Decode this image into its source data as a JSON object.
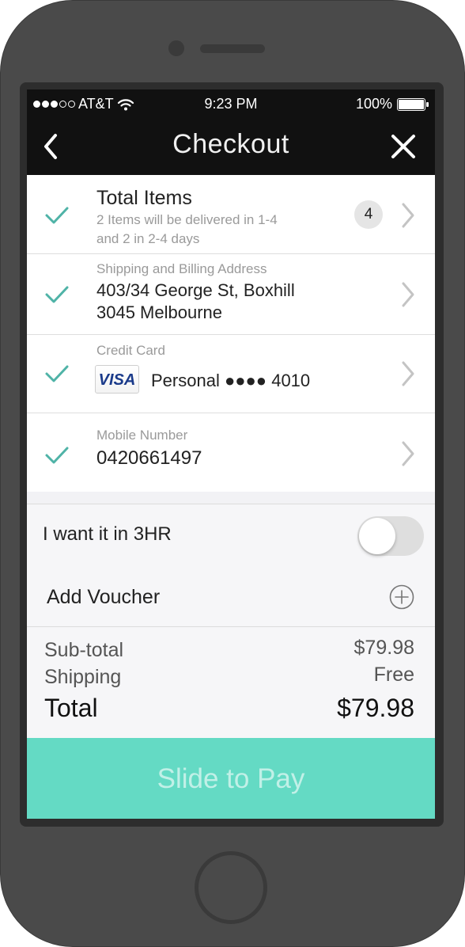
{
  "status_bar": {
    "carrier": "AT&T",
    "time": "9:23 PM",
    "battery": "100%",
    "signal_bars_filled": 3,
    "signal_bars_total": 5
  },
  "nav": {
    "title": "Checkout",
    "back_icon": "chevron-left-icon",
    "close_icon": "close-icon"
  },
  "rows": {
    "items": {
      "title": "Total Items",
      "subtitle_line1": "2 Items will be delivered in 1-4",
      "subtitle_line2": "and 2 in 2-4 days",
      "count": "4"
    },
    "address": {
      "label": "Shipping and Billing Address",
      "line1": "403/34 George St, Boxhill",
      "line2": "3045 Melbourne"
    },
    "card": {
      "label": "Credit Card",
      "brand": "VISA",
      "description": "Personal ●●●● 4010"
    },
    "mobile": {
      "label": "Mobile Number",
      "value": "0420661497"
    }
  },
  "options": {
    "express_label": "I want it in 3HR",
    "express_enabled": false,
    "voucher_label": "Add Voucher"
  },
  "totals": {
    "subtotal_label": "Sub-total",
    "subtotal_value": "$79.98",
    "shipping_label": "Shipping",
    "shipping_value": "Free",
    "total_label": "Total",
    "total_value": "$79.98"
  },
  "pay": {
    "label": "Slide to Pay"
  },
  "colors": {
    "accent_teal": "#64dac4",
    "check_teal": "#4fb3a7",
    "nav_bg": "#111111"
  }
}
